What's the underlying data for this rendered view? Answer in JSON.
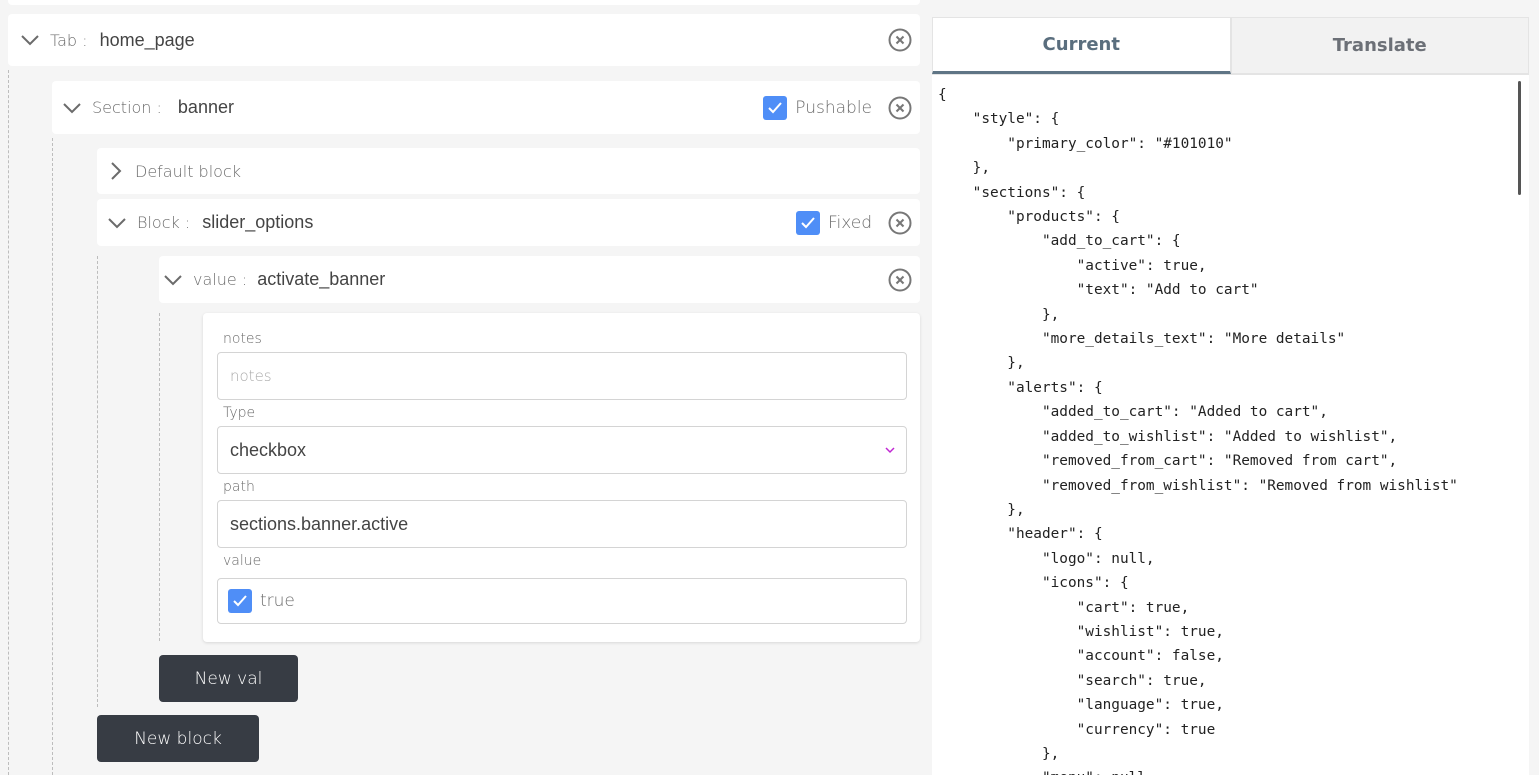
{
  "tab": {
    "label": "Tab :",
    "value": "home_page"
  },
  "section": {
    "label": "Section :",
    "value": "banner",
    "flag_label": "Pushable",
    "flag_checked": true
  },
  "default_block": {
    "label": "Default block"
  },
  "block": {
    "label": "Block :",
    "value": "slider_options",
    "flag_label": "Fixed",
    "flag_checked": true
  },
  "value_row": {
    "label": "value :",
    "value": "activate_banner"
  },
  "form": {
    "notes_label": "notes",
    "notes_placeholder": "notes",
    "type_label": "Type",
    "type_value": "checkbox",
    "path_label": "path",
    "path_value": "sections.banner.active",
    "value_label": "value",
    "value_text": "true",
    "value_checked": true
  },
  "buttons": {
    "new_val": "New val",
    "new_block": "New block"
  },
  "panel": {
    "tabs": [
      {
        "label": "Current",
        "active": true
      },
      {
        "label": "Translate",
        "active": false
      }
    ],
    "json_lines": [
      "{",
      "    \"style\": {",
      "        \"primary_color\": \"#101010\"",
      "    },",
      "    \"sections\": {",
      "        \"products\": {",
      "            \"add_to_cart\": {",
      "                \"active\": true,",
      "                \"text\": \"Add to cart\"",
      "            },",
      "            \"more_details_text\": \"More details\"",
      "        },",
      "        \"alerts\": {",
      "            \"added_to_cart\": \"Added to cart\",",
      "            \"added_to_wishlist\": \"Added to wishlist\",",
      "            \"removed_from_cart\": \"Removed from cart\",",
      "            \"removed_from_wishlist\": \"Removed from wishlist\"",
      "        },",
      "        \"header\": {",
      "            \"logo\": null,",
      "            \"icons\": {",
      "                \"cart\": true,",
      "                \"wishlist\": true,",
      "                \"account\": false,",
      "                \"search\": true,",
      "                \"language\": true,",
      "                \"currency\": true",
      "            },",
      "            \"menu\": null,"
    ]
  },
  "colors": {
    "checkbox": "#4f8ef7",
    "button": "#373c44",
    "tab_accent": "#5f7585",
    "select_arrow": "#c026d3"
  }
}
